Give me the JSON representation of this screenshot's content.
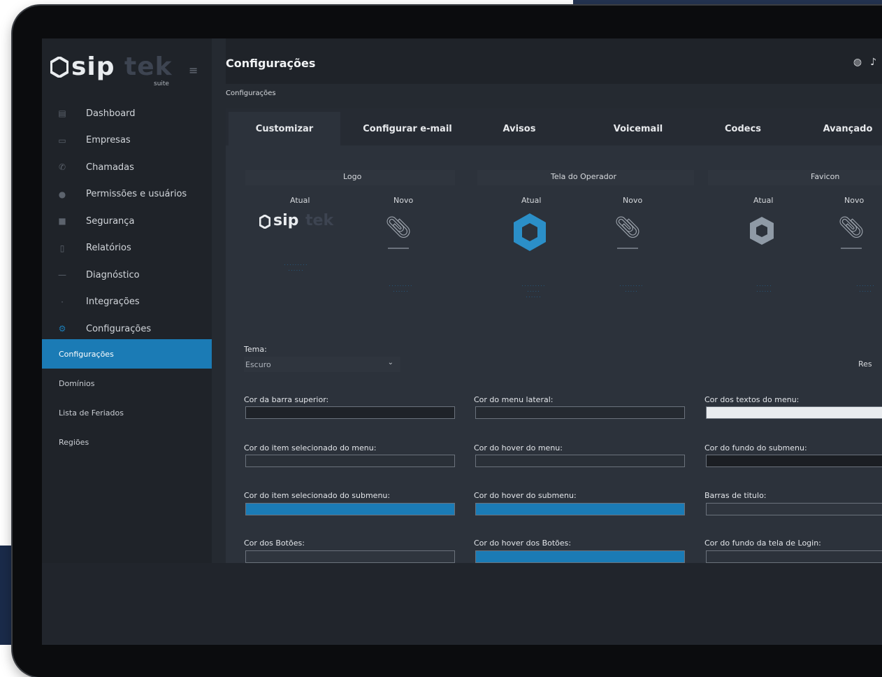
{
  "brand": {
    "sip": "sip",
    "tek": "tek",
    "suite": "suite"
  },
  "sidebar": {
    "items": [
      {
        "label": "Dashboard",
        "icon": "chart-icon"
      },
      {
        "label": "Empresas",
        "icon": "building-icon"
      },
      {
        "label": "Chamadas",
        "icon": "phone-icon"
      },
      {
        "label": "Permissões e usuários",
        "icon": "user-icon"
      },
      {
        "label": "Segurança",
        "icon": "lock-icon"
      },
      {
        "label": "Relatórios",
        "icon": "report-icon"
      },
      {
        "label": "Diagnóstico",
        "icon": "pulse-icon"
      },
      {
        "label": "Integrações",
        "icon": "plug-icon"
      },
      {
        "label": "Configurações",
        "icon": "gear-icon"
      }
    ],
    "submenu": [
      {
        "label": "Configurações",
        "active": true
      },
      {
        "label": "Domínios",
        "active": false
      },
      {
        "label": "Lista de Feriados",
        "active": false
      },
      {
        "label": "Regiões",
        "active": false
      }
    ]
  },
  "header": {
    "title": "Configurações",
    "icons": [
      "globe-icon",
      "bell-icon"
    ]
  },
  "breadcrumb": "Configurações",
  "tabs": [
    {
      "label": "Customizar",
      "active": true
    },
    {
      "label": "Configurar e-mail",
      "active": false
    },
    {
      "label": "Avisos",
      "active": false
    },
    {
      "label": "Voicemail",
      "active": false
    },
    {
      "label": "Codecs",
      "active": false
    },
    {
      "label": "Avançado",
      "active": false
    }
  ],
  "sections": [
    {
      "title": "Logo",
      "current": "Atual",
      "new": "Novo"
    },
    {
      "title": "Tela do Operador",
      "current": "Atual",
      "new": "Novo"
    },
    {
      "title": "Favicon",
      "current": "Atual",
      "new": "Novo"
    }
  ],
  "theme": {
    "label": "Tema:",
    "value": "Escuro",
    "reset_cut": "Res"
  },
  "colors": {
    "accent": "#1b7bb5",
    "fields": [
      {
        "label": "Cor da barra superior:",
        "value": "#1f2329"
      },
      {
        "label": "Cor do menu lateral:",
        "value": "#252a31"
      },
      {
        "label": "Cor dos textos do menu:",
        "value": "#e9ecef"
      },
      {
        "label": "Cor do item selecionado do menu:",
        "value": "#2a3038"
      },
      {
        "label": "Cor do hover do menu:",
        "value": "#2a3038"
      },
      {
        "label": "Cor do fundo do submenu:",
        "value": "#1b1e23"
      },
      {
        "label": "Cor do item selecionado do submenu:",
        "value": "#1b7bb5"
      },
      {
        "label": "Cor do hover do submenu:",
        "value": "#1b7bb5"
      },
      {
        "label": "Barras de titulo:",
        "value": "#2f353e"
      },
      {
        "label": "Cor dos Botões:",
        "value": "#2f353e"
      },
      {
        "label": "Cor do hover dos Botões:",
        "value": "#1b7bb5"
      },
      {
        "label": "Cor do fundo da tela de Login:",
        "value": "#2c323b"
      }
    ]
  }
}
